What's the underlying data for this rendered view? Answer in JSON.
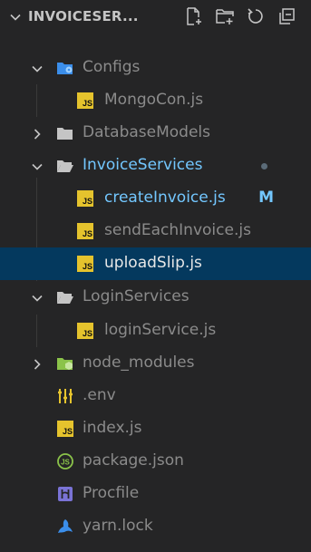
{
  "explorer": {
    "root_title": "INVOICESER...",
    "actions": {
      "new_file": "new-file-icon",
      "new_folder": "new-folder-icon",
      "refresh": "refresh-icon",
      "collapse": "collapse-all-icon"
    }
  },
  "tree": [
    {
      "label": "Configs",
      "type": "folder",
      "expanded": true,
      "level": 1
    },
    {
      "label": "MongoCon.js",
      "type": "js",
      "level": 2
    },
    {
      "label": "DatabaseModels",
      "type": "folder",
      "expanded": false,
      "level": 1
    },
    {
      "label": "InvoiceServices",
      "type": "folder",
      "expanded": true,
      "level": 1,
      "status": "modified-dot"
    },
    {
      "label": "createInvoice.js",
      "type": "js",
      "level": 2,
      "badge": "M"
    },
    {
      "label": "sendEachInvoice.js",
      "type": "js",
      "level": 2
    },
    {
      "label": "uploadSlip.js",
      "type": "js",
      "level": 2,
      "selected": true
    },
    {
      "label": "LoginServices",
      "type": "folder",
      "expanded": true,
      "level": 1
    },
    {
      "label": "loginService.js",
      "type": "js",
      "level": 2
    },
    {
      "label": "node_modules",
      "type": "folder",
      "expanded": false,
      "level": 1
    },
    {
      "label": ".env",
      "type": "env",
      "level": 1
    },
    {
      "label": "index.js",
      "type": "js",
      "level": 1
    },
    {
      "label": "package.json",
      "type": "json",
      "level": 1
    },
    {
      "label": "Procfile",
      "type": "procfile",
      "level": 1
    },
    {
      "label": "yarn.lock",
      "type": "yarn",
      "level": 1
    }
  ],
  "colors": {
    "background": "#252526",
    "selected_row": "#04395e",
    "modified": "#73c7ff",
    "js_icon": "#e5c32d"
  }
}
